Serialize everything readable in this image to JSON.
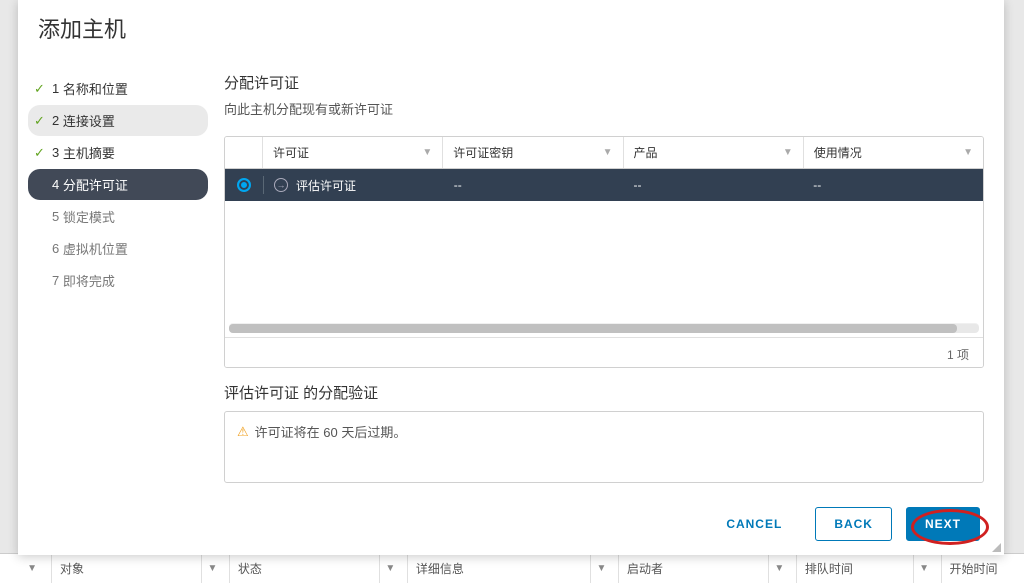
{
  "modal_title": "添加主机",
  "wizard_steps": [
    {
      "num": "1",
      "label": "名称和位置",
      "state": "done"
    },
    {
      "num": "2",
      "label": "连接设置",
      "state": "done-highlighted"
    },
    {
      "num": "3",
      "label": "主机摘要",
      "state": "done"
    },
    {
      "num": "4",
      "label": "分配许可证",
      "state": "current"
    },
    {
      "num": "5",
      "label": "锁定模式",
      "state": "future"
    },
    {
      "num": "6",
      "label": "虚拟机位置",
      "state": "future"
    },
    {
      "num": "7",
      "label": "即将完成",
      "state": "future"
    }
  ],
  "content": {
    "title": "分配许可证",
    "desc": "向此主机分配现有或新许可证"
  },
  "grid": {
    "columns": [
      "许可证",
      "许可证密钥",
      "产品",
      "使用情况"
    ],
    "row": {
      "license_name": "评估许可证",
      "key": "--",
      "product": "--",
      "usage": "--"
    },
    "footer": "1 项"
  },
  "validation": {
    "title": "评估许可证 的分配验证",
    "message": "许可证将在 60 天后过期。"
  },
  "footer": {
    "cancel": "CANCEL",
    "back": "BACK",
    "next": "NEXT"
  },
  "bottom_columns": [
    "对象",
    "状态",
    "详细信息",
    "启动者",
    "排队时间",
    "开始时间"
  ]
}
